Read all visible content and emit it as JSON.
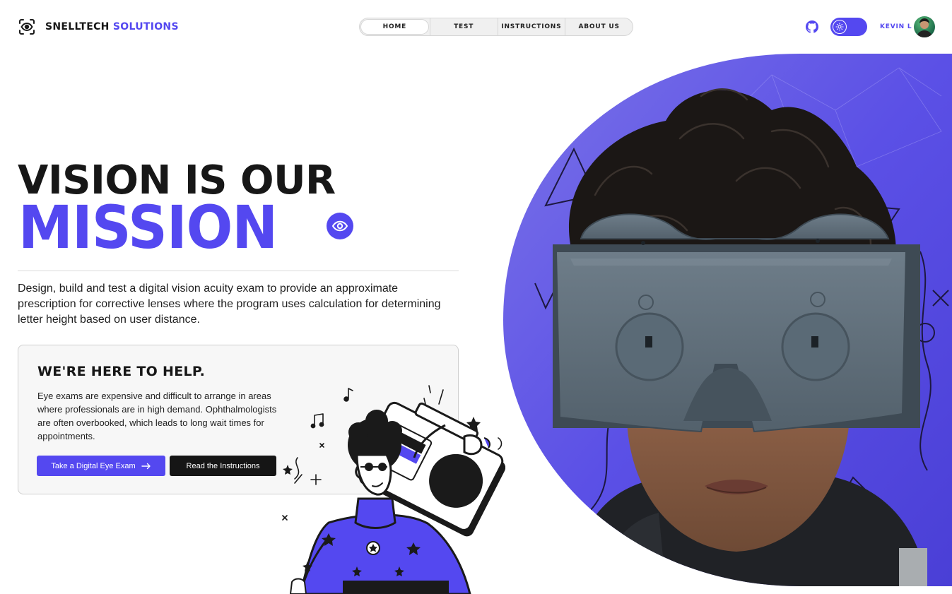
{
  "brand": {
    "name_part1": "SNELLTECH",
    "name_part2": "SOLUTIONS"
  },
  "nav": {
    "items": [
      {
        "label": "HOME",
        "active": true
      },
      {
        "label": "TEST",
        "active": false
      },
      {
        "label": "INSTRUCTIONS",
        "active": false
      },
      {
        "label": "ABOUT US",
        "active": false
      }
    ]
  },
  "header": {
    "github_icon": "github-icon",
    "theme_toggle_icon": "sun-icon",
    "theme_toggle_on": true,
    "user_name": "KEVIN L"
  },
  "hero": {
    "title_line1": "VISION IS OUR",
    "title_line2": "MISSION",
    "title_icon": "eye-icon",
    "description": "Design, build and test a digital vision acuity exam to provide an approximate prescription for corrective lenses where the program uses calculation for determining letter height based on user distance."
  },
  "help_card": {
    "title": "WE'RE HERE TO HELP.",
    "text": "Eye exams are expensive and difficult to arrange in areas where professionals are in high demand. Ophthalmologists are often overbooked, which leads to long wait times for appointments.",
    "primary_button": "Take a Digital Eye Exam",
    "primary_button_icon": "arrow-right-icon",
    "secondary_button": "Read the Instructions"
  },
  "colors": {
    "accent": "#5448f0",
    "dark": "#151515",
    "card_bg": "#f7f7f7",
    "headset": "#5f6f7b"
  }
}
